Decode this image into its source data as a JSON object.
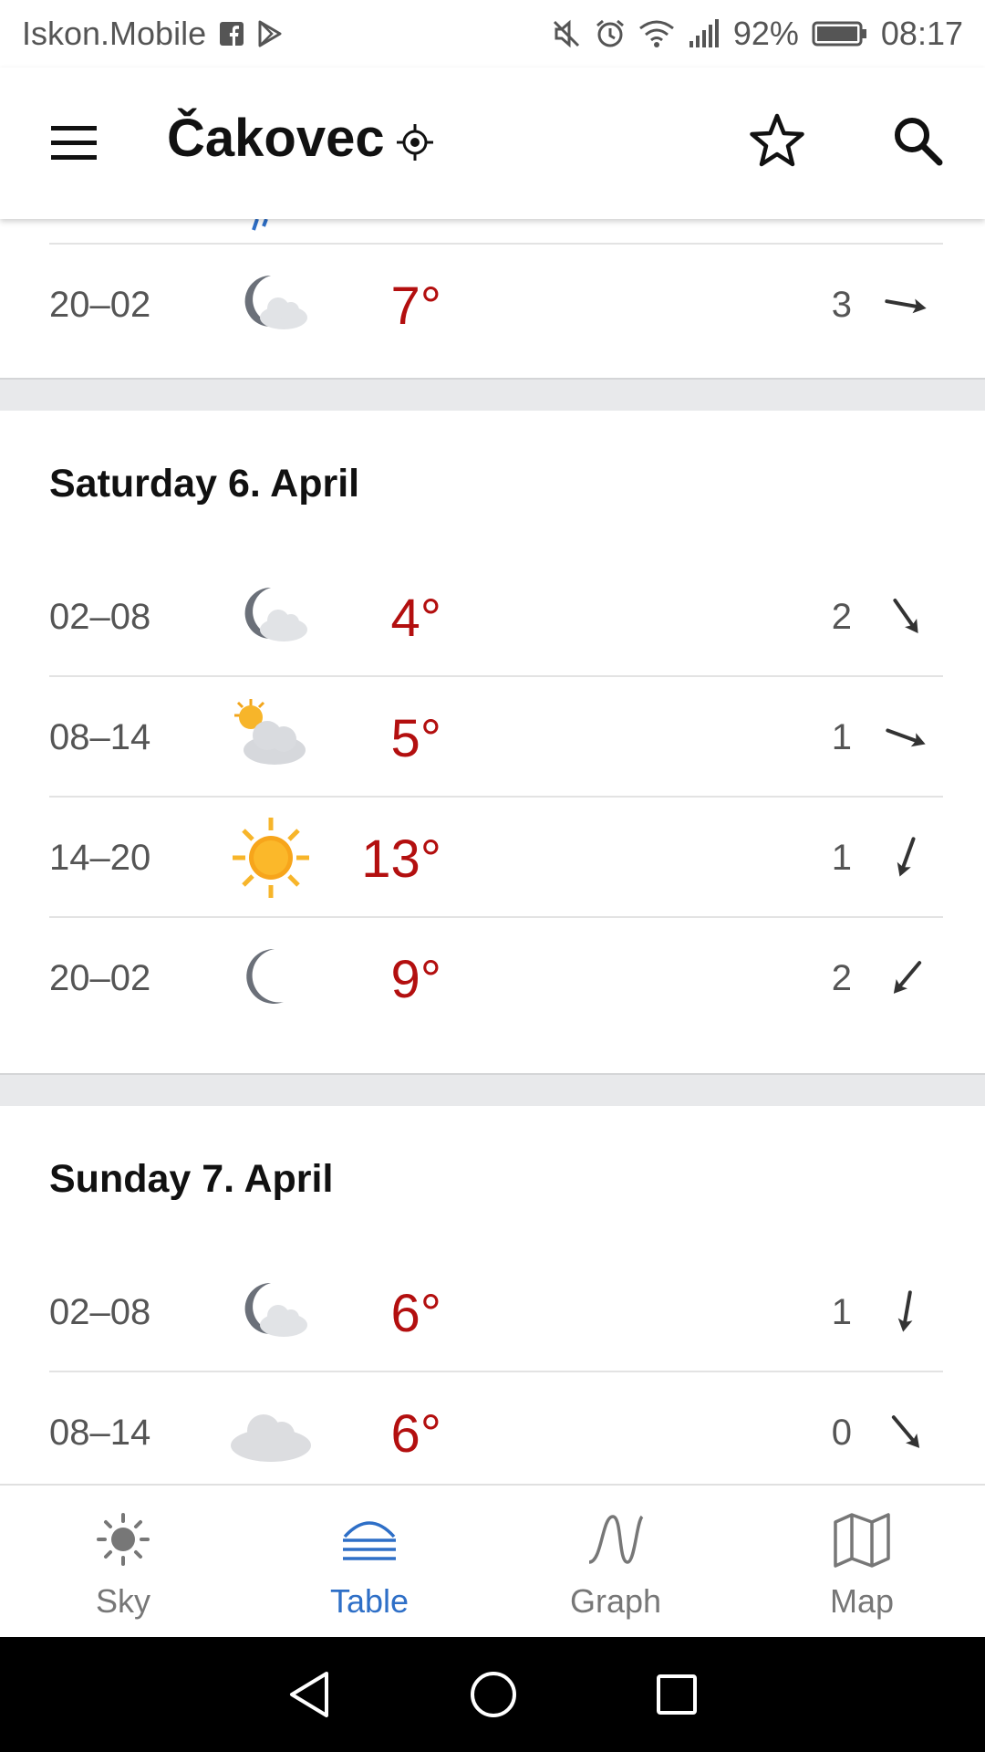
{
  "status": {
    "carrier": "Iskon.Mobile",
    "battery": "92%",
    "time": "08:17"
  },
  "header": {
    "city": "Čakovec"
  },
  "prev_rows": [
    {
      "time": "20–02",
      "icon": "moon-cloud-icon",
      "temp": "7°",
      "wind": "3",
      "wind_dir": 100
    }
  ],
  "days": [
    {
      "label": "Saturday 6. April",
      "rows": [
        {
          "time": "02–08",
          "icon": "moon-cloud-icon",
          "temp": "4°",
          "wind": "2",
          "wind_dir": 145
        },
        {
          "time": "08–14",
          "icon": "sun-cloud-icon",
          "temp": "5°",
          "wind": "1",
          "wind_dir": 110
        },
        {
          "time": "14–20",
          "icon": "sun-icon",
          "temp": "13°",
          "wind": "1",
          "wind_dir": 200
        },
        {
          "time": "20–02",
          "icon": "moon-icon",
          "temp": "9°",
          "wind": "2",
          "wind_dir": 220
        }
      ]
    },
    {
      "label": "Sunday 7. April",
      "rows": [
        {
          "time": "02–08",
          "icon": "moon-cloud-icon",
          "temp": "6°",
          "wind": "1",
          "wind_dir": 190
        },
        {
          "time": "08–14",
          "icon": "cloud-icon",
          "temp": "6°",
          "wind": "0",
          "wind_dir": 140
        }
      ]
    }
  ],
  "nav": [
    {
      "label": "Sky",
      "icon": "sun-outline-icon",
      "active": false
    },
    {
      "label": "Table",
      "icon": "table-waves-icon",
      "active": true
    },
    {
      "label": "Graph",
      "icon": "graph-curve-icon",
      "active": false
    },
    {
      "label": "Map",
      "icon": "map-icon",
      "active": false
    }
  ],
  "colors": {
    "temperature": "#b30f0f",
    "accent": "#2e6fc7",
    "separator_band": "#e8e9eb"
  }
}
